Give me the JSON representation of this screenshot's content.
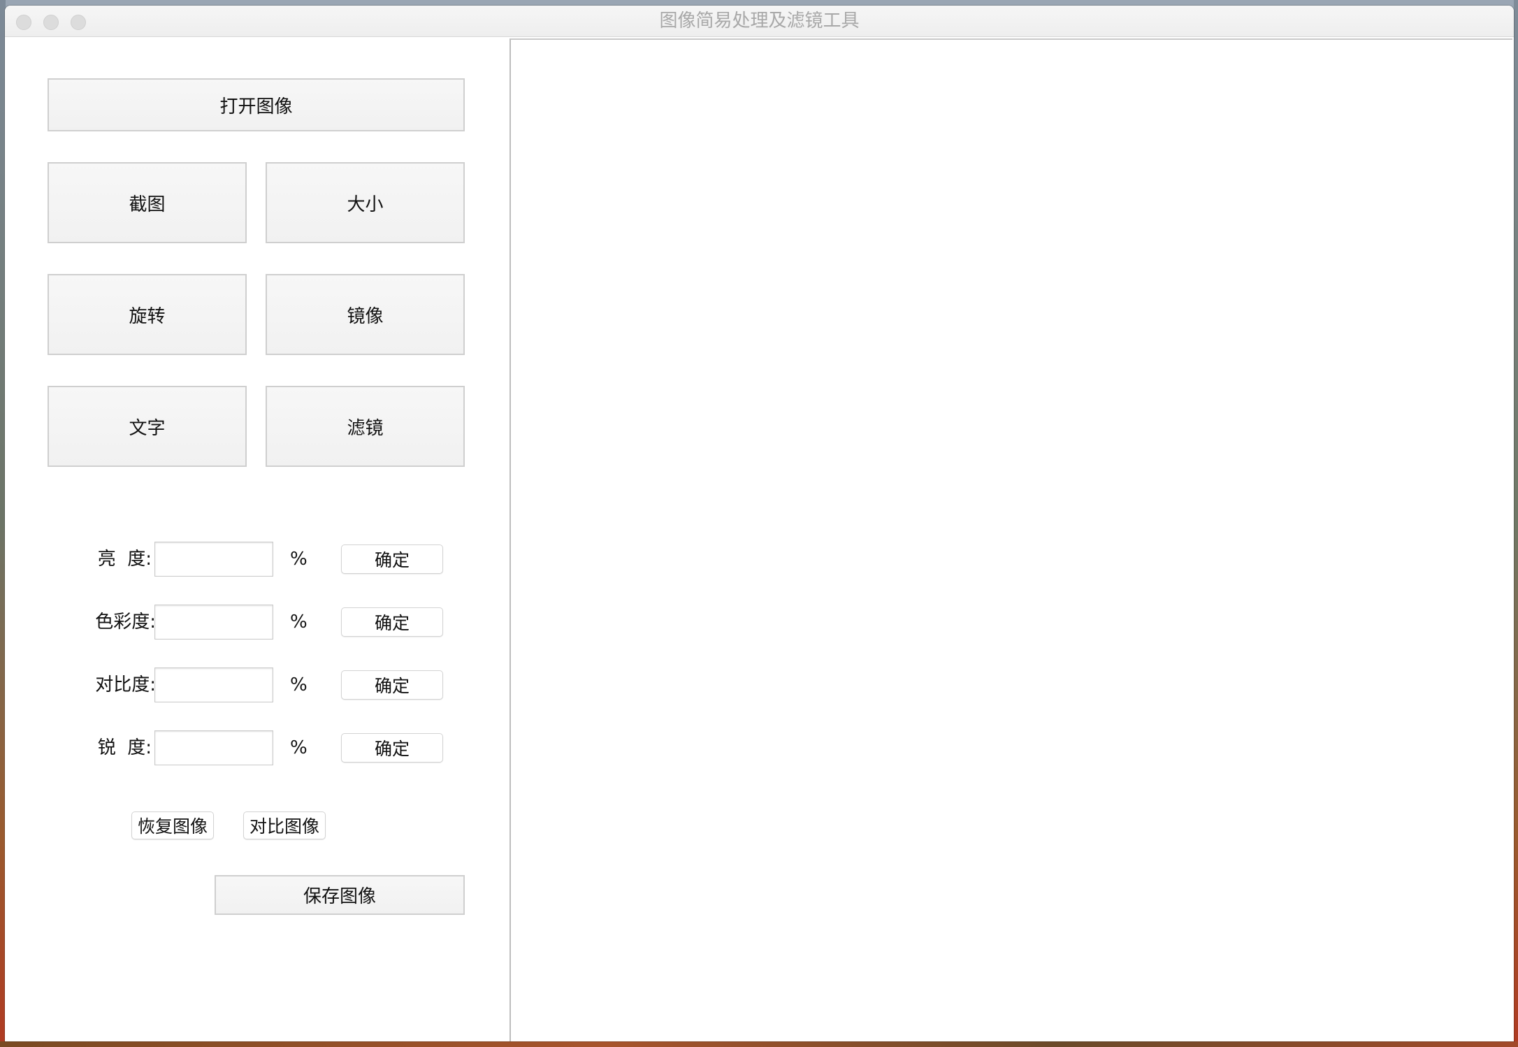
{
  "window": {
    "title": "图像简易处理及滤镜工具"
  },
  "toolbar": {
    "open_label": "打开图像",
    "crop_label": "截图",
    "resize_label": "大小",
    "rotate_label": "旋转",
    "mirror_label": "镜像",
    "text_label": "文字",
    "filter_label": "滤镜"
  },
  "adjustments": [
    {
      "label": "亮  度:",
      "value": "",
      "unit": "%",
      "confirm": "确定"
    },
    {
      "label": "色彩度:",
      "value": "",
      "unit": "%",
      "confirm": "确定"
    },
    {
      "label": "对比度:",
      "value": "",
      "unit": "%",
      "confirm": "确定"
    },
    {
      "label": "锐  度:",
      "value": "",
      "unit": "%",
      "confirm": "确定"
    }
  ],
  "actions": {
    "restore_label": "恢复图像",
    "compare_label": "对比图像",
    "save_label": "保存图像"
  }
}
